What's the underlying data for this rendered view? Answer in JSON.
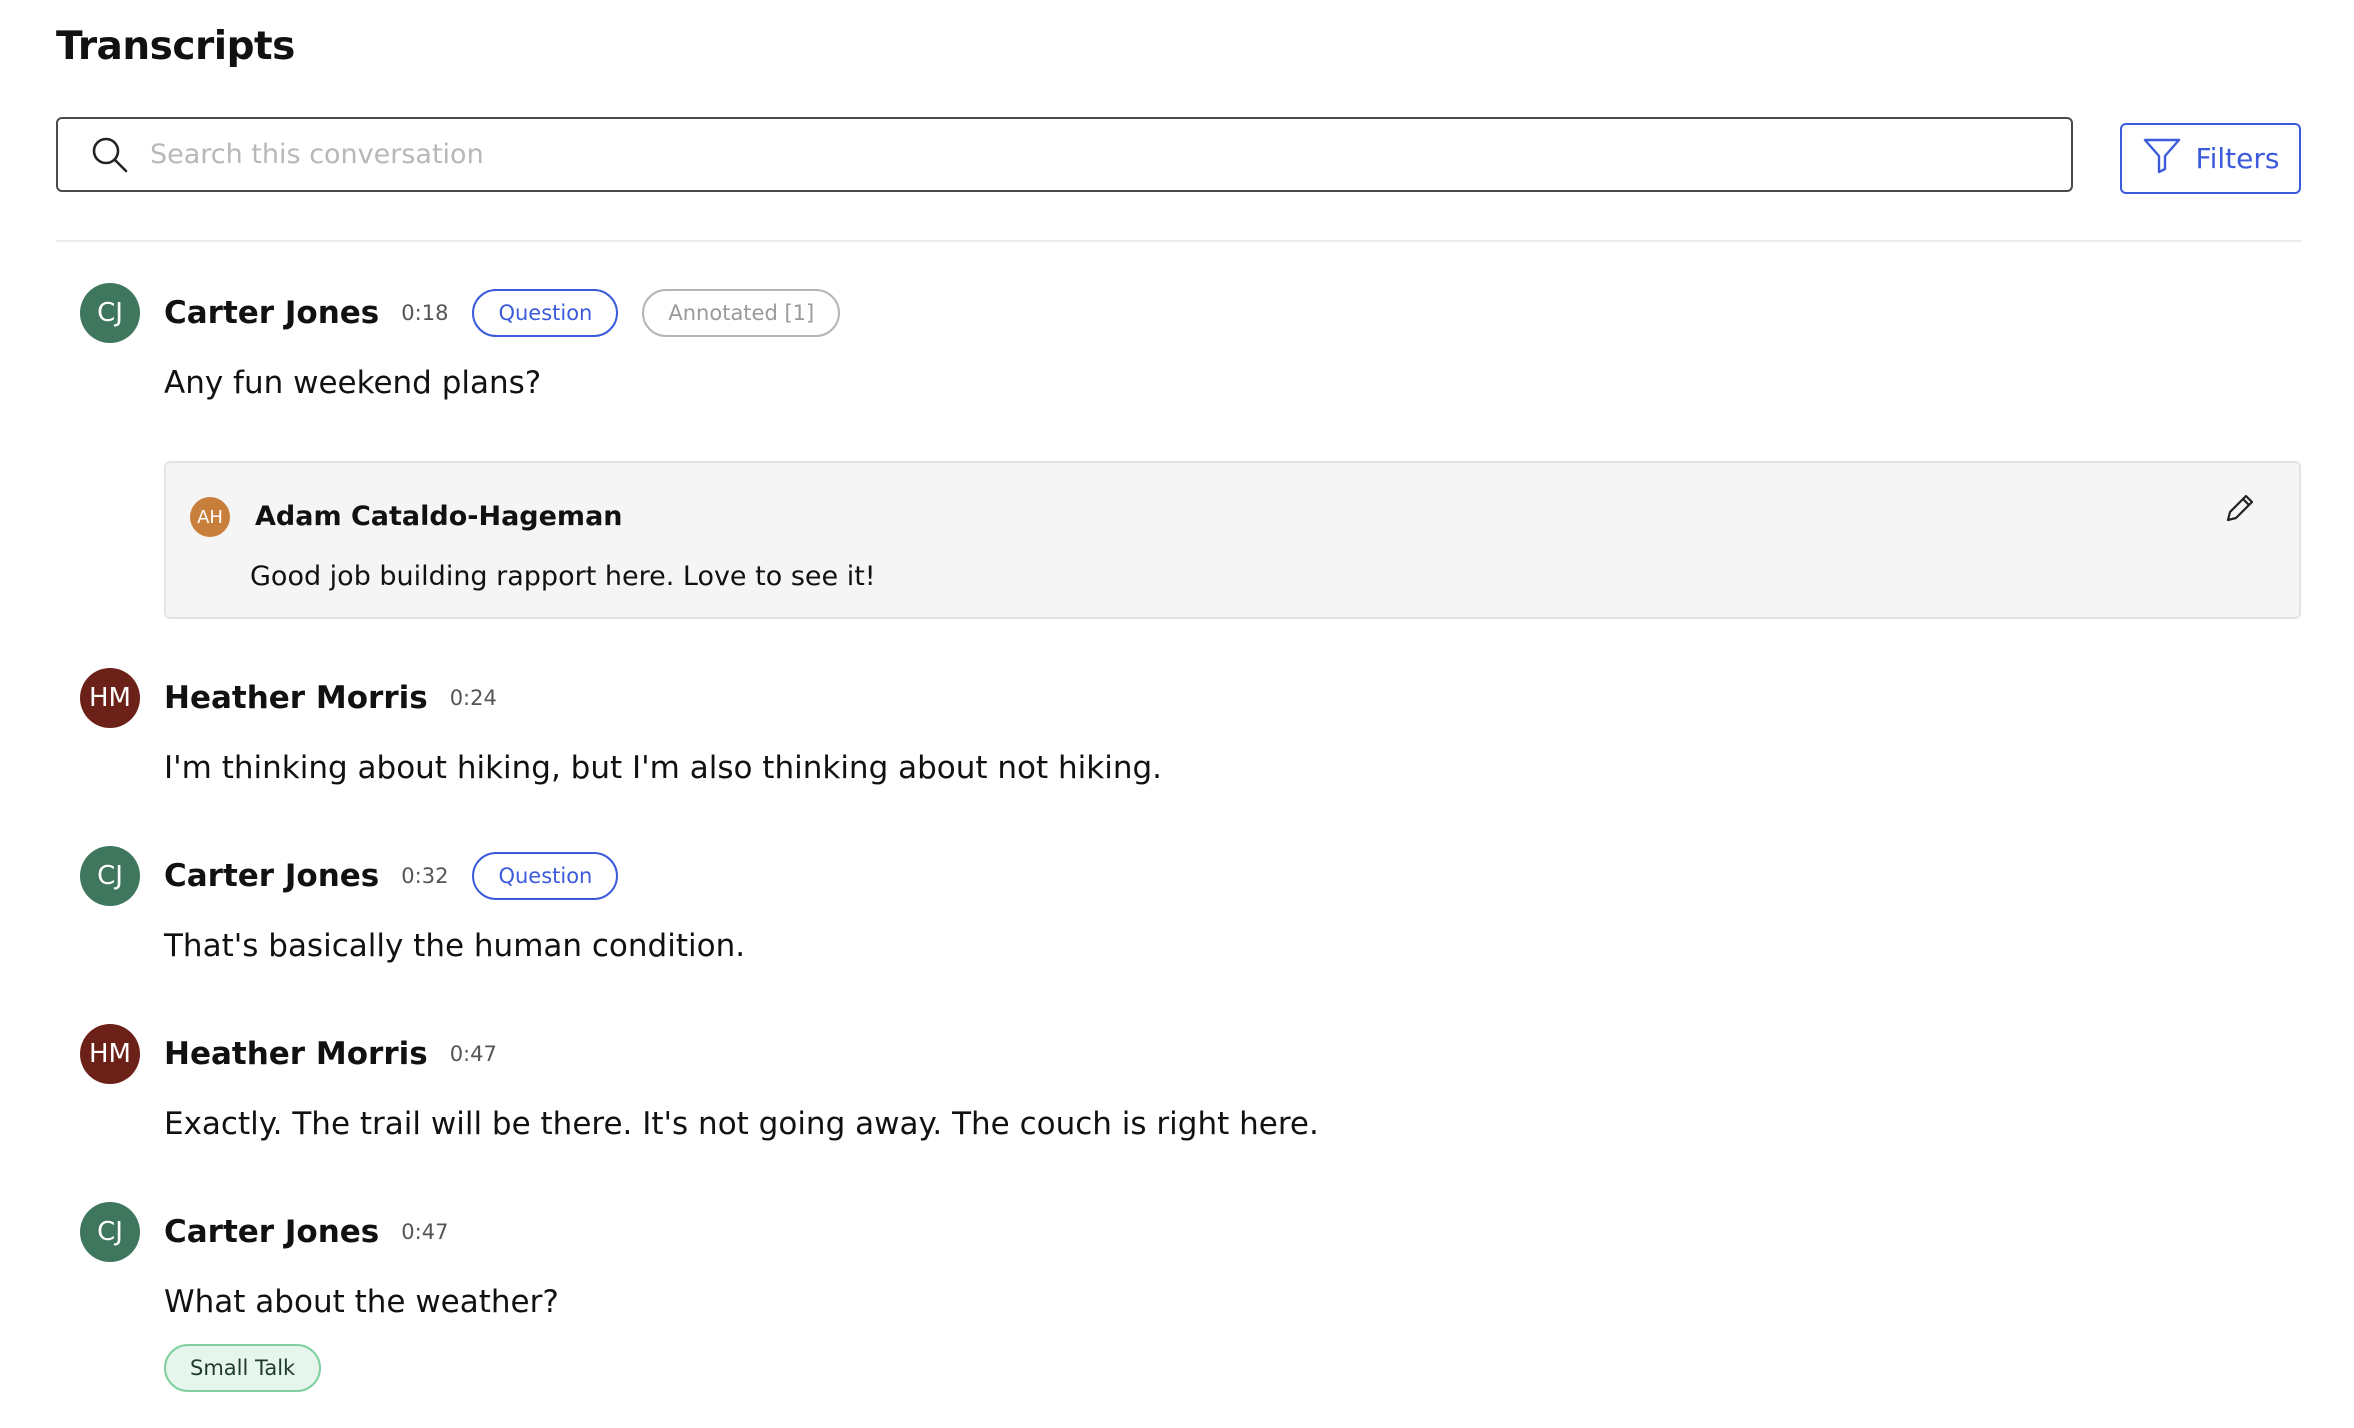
{
  "header": {
    "title": "Transcripts"
  },
  "search": {
    "placeholder": "Search this conversation",
    "value": ""
  },
  "filters": {
    "label": "Filters"
  },
  "colors": {
    "accent": "#3b5bdb",
    "cj_avatar": "#3f765e",
    "hm_avatar": "#6b2118",
    "ah_avatar": "#c87f3c",
    "small_talk_bg": "#e6f6ec",
    "small_talk_border": "#7fcf9f"
  },
  "messages": [
    {
      "initials": "CJ",
      "speaker": "Carter Jones",
      "time": "0:18",
      "tags": [
        "Question",
        "Annotated [1]"
      ],
      "text": "Any fun weekend plans?"
    },
    {
      "initials": "HM",
      "speaker": "Heather Morris",
      "time": "0:24",
      "tags": [],
      "text": "I'm thinking about hiking, but I'm also thinking about not hiking."
    },
    {
      "initials": "CJ",
      "speaker": "Carter Jones",
      "time": "0:32",
      "tags": [
        "Question"
      ],
      "text": "That's basically the human condition."
    },
    {
      "initials": "HM",
      "speaker": "Heather Morris",
      "time": "0:47",
      "tags": [],
      "text": "Exactly. The trail will be there. It's not going away. The couch is right here."
    },
    {
      "initials": "CJ",
      "speaker": "Carter Jones",
      "time": "0:47",
      "tags": [],
      "text": "What about the weather?",
      "topic_tag": "Small Talk"
    }
  ],
  "annotation": {
    "initials": "AH",
    "author": "Adam Cataldo-Hageman",
    "text": "Good job building rapport here. Love to see it!",
    "edit_icon": "pencil-icon"
  },
  "icons": {
    "search": "search-icon",
    "filters": "funnel-icon"
  }
}
